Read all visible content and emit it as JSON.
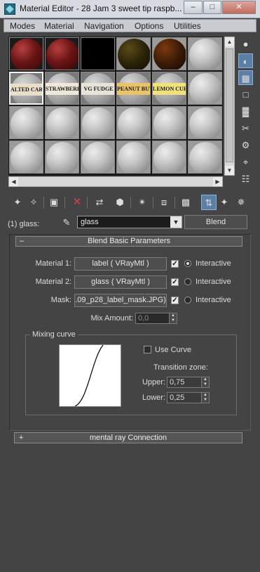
{
  "window": {
    "title": "Material Editor - 28 Jam 3 sweet tip raspb..."
  },
  "menu": {
    "items": [
      "Modes",
      "Material",
      "Navigation",
      "Options",
      "Utilities"
    ]
  },
  "slots": {
    "row2_labels": [
      "ALTED CARAM",
      "STRAWBERR",
      "VG FUDGE",
      "PEANUT BUTT",
      "LEMON CURD"
    ]
  },
  "name_row": {
    "label": "(1) glass:",
    "material_name": "glass",
    "type_button": "Blend"
  },
  "blend": {
    "header": "Blend Basic Parameters",
    "collapse_sign": "–",
    "material1_label": "Material 1:",
    "material1_value": "label  ( VRayMtl )",
    "material2_label": "Material 2:",
    "material2_value": "glass  ( VRayMtl )",
    "mask_label": "Mask:",
    "mask_value": ".09_p28_label_mask.JPG)",
    "interactive_label": "Interactive",
    "mix_amount_label": "Mix Amount:",
    "mix_amount_value": "0,0",
    "mixing_curve_label": "Mixing curve",
    "use_curve_label": "Use Curve",
    "transition_zone_label": "Transition zone:",
    "upper_label": "Upper:",
    "upper_value": "0,75",
    "lower_label": "Lower:",
    "lower_value": "0,25"
  },
  "mental_ray": {
    "header": "mental ray Connection",
    "expand_sign": "+"
  },
  "colors": {
    "background": "#444444",
    "accent_blue": "#5b7fa6"
  }
}
